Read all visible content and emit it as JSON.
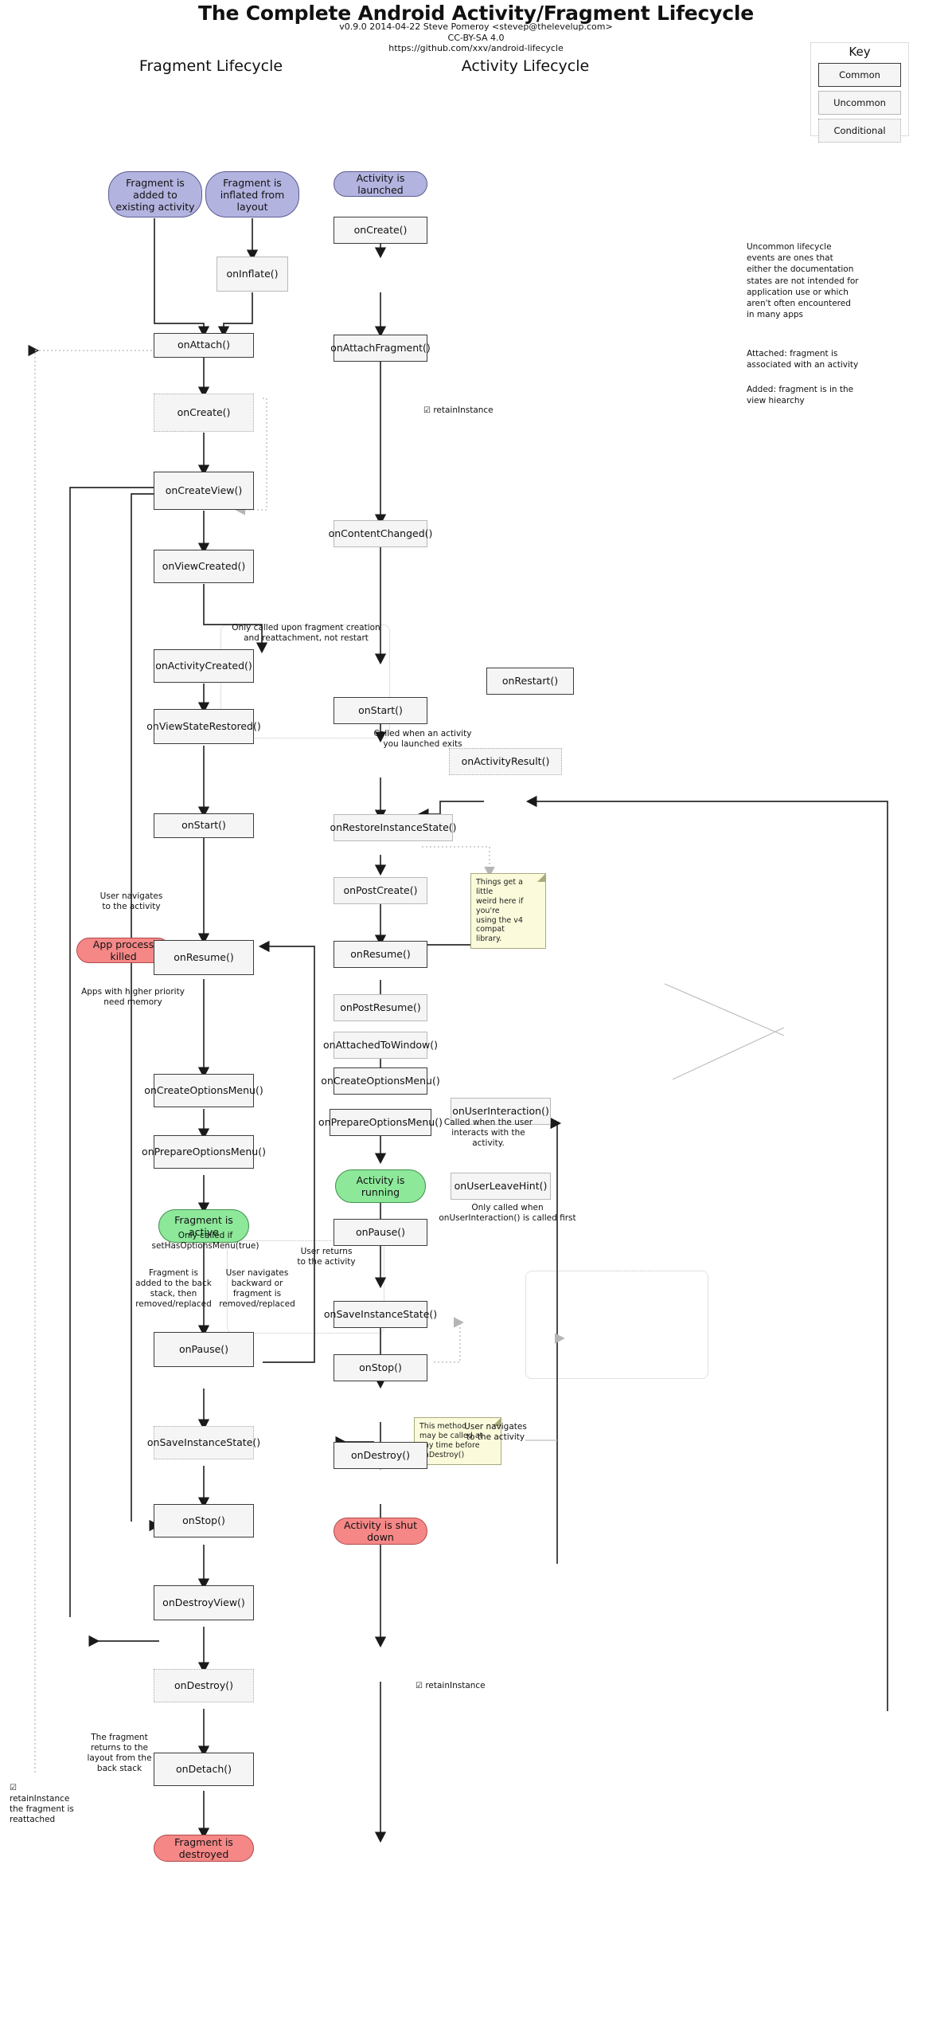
{
  "header": {
    "title": "The Complete Android Activity/Fragment Lifecycle",
    "version_line": "v0.9.0 2014-04-22 Steve Pomeroy <stevep@thelevelup.com>",
    "license": "CC-BY-SA 4.0",
    "url": "https://github.com/xxv/android-lifecycle"
  },
  "columns": {
    "fragment": "Fragment Lifecycle",
    "activity": "Activity Lifecycle"
  },
  "key": {
    "title": "Key",
    "items": [
      {
        "label": "Common",
        "style": "common"
      },
      {
        "label": "Uncommon",
        "style": "uncommon"
      },
      {
        "label": "Conditional",
        "style": "conditional"
      }
    ]
  },
  "side_notes": {
    "uncommon_explainer": "Uncommon lifecycle\nevents are ones that\neither the documentation\nstates are not intended for\napplication use or which\naren't often encountered\nin many apps",
    "attached_def": "Attached: fragment is\nassociated with an activity",
    "added_def": "Added: fragment is in the\nview hiearchy"
  },
  "fragment_nodes": {
    "added_to_existing": "Fragment is\nadded to\nexisting activity",
    "inflated_from_layout": "Fragment is\ninflated from\nlayout",
    "onInflate": "onInflate()",
    "onAttach": "onAttach()",
    "onCreate": "onCreate()",
    "onCreateView": "onCreateView()",
    "onViewCreated": "onViewCreated()",
    "onActivityCreated": "onActivityCreated()",
    "onViewStateRestored": "onViewStateRestored()",
    "onStart": "onStart()",
    "app_process_killed": "App process\nkilled",
    "onResume": "onResume()",
    "onCreateOptionsMenu": "onCreateOptionsMenu()",
    "onPrepareOptionsMenu": "onPrepareOptionsMenu()",
    "fragment_active": "Fragment is\nactive",
    "onPause": "onPause()",
    "onSaveInstanceState": "onSaveInstanceState()",
    "onStop": "onStop()",
    "onDestroyView": "onDestroyView()",
    "onDestroy": "onDestroy()",
    "onDetach": "onDetach()",
    "fragment_destroyed": "Fragment is\ndestroyed"
  },
  "fragment_notes": {
    "retain_instance_top": "retainInstance",
    "only_called_creation": "Only called upon fragment creation\nand reattachment, not restart",
    "user_navigates_to_activity": "User navigates\nto the activity",
    "apps_higher_priority": "Apps with higher priority\nneed memory",
    "only_called_if_menu": "Only called if\nsetHasOptionsMenu(true)",
    "added_back_stack": "Fragment is\nadded to the back\nstack, then\nremoved/replaced",
    "user_navigates_backward": "User navigates\nbackward or\nfragment is\nremoved/replaced",
    "fragment_returns_layout": "The fragment\nreturns to the\nlayout from the\nback stack",
    "retain_instance_reattached": "retainInstance\nthe fragment is\nreattached",
    "retain_instance_bottom": "retainInstance",
    "save_state_sticky": "This method\nmay be called at\nany time before\nonDestroy()"
  },
  "activity_nodes": {
    "activity_launched": "Activity is\nlaunched",
    "onCreate": "onCreate()",
    "onAttachFragment": "onAttachFragment()",
    "onContentChanged": "onContentChanged()",
    "onRestart": "onRestart()",
    "onStart": "onStart()",
    "onActivityResult": "onActivityResult()",
    "onRestoreInstanceState": "onRestoreInstanceState()",
    "onPostCreate": "onPostCreate()",
    "onResume": "onResume()",
    "onPostResume": "onPostResume()",
    "onAttachedToWindow": "onAttachedToWindow()",
    "onCreateOptionsMenu": "onCreateOptionsMenu()",
    "onPrepareOptionsMenu": "onPrepareOptionsMenu()",
    "onUserInteraction": "onUserInteraction()",
    "onUserLeaveHint": "onUserLeaveHint()",
    "activity_running": "Activity is\nrunning",
    "onPause": "onPause()",
    "onSaveInstanceState": "onSaveInstanceState()",
    "onStop": "onStop()",
    "onDestroy": "onDestroy()",
    "activity_shut_down": "Activity is\nshut down"
  },
  "activity_notes": {
    "called_when_launched_exits": "Called when an activity\nyou launched exits",
    "v4_compat_sticky": "Things get a little\nweird here if you're\nusing the v4 compat\nlibrary.",
    "called_when_user_interacts": "Called when the user\ninteracts with the\nactivity.",
    "only_called_when_userinteraction": "Only called when\nonUserInteraction() is called first",
    "user_returns_to_activity": "User returns\nto the activity",
    "user_navigates_to_activity": "User navigates\nto the activity"
  },
  "colors": {
    "start": "#b3b3e0",
    "active": "#8ee89a",
    "dead": "#f58787",
    "node_fill": "#f5f5f5",
    "sticky": "#fbfbdc"
  }
}
